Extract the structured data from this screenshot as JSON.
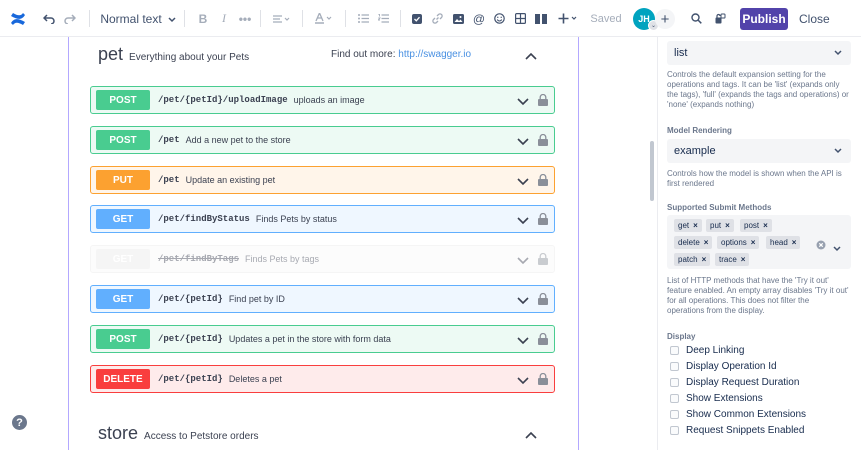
{
  "toolbar": {
    "text_style": "Normal text",
    "saved": "Saved",
    "avatar_initials": "JH",
    "publish": "Publish",
    "close": "Close"
  },
  "tags": [
    {
      "name": "pet",
      "description": "Everything about your Pets",
      "find_more": "Find out more:",
      "link": "http://swagger.io"
    },
    {
      "name": "store",
      "description": "Access to Petstore orders"
    }
  ],
  "operations": [
    {
      "method": "POST",
      "path": "/pet/{petId}/uploadImage",
      "summary": "uploads an image",
      "color": "#49cc90",
      "bg": "#edfaf4"
    },
    {
      "method": "POST",
      "path": "/pet",
      "summary": "Add a new pet to the store",
      "color": "#49cc90",
      "bg": "#edfaf4"
    },
    {
      "method": "PUT",
      "path": "/pet",
      "summary": "Update an existing pet",
      "color": "#fca130",
      "bg": "#fff5ea"
    },
    {
      "method": "GET",
      "path": "/pet/findByStatus",
      "summary": "Finds Pets by status",
      "color": "#61affe",
      "bg": "#eff7ff"
    },
    {
      "method": "GET",
      "path": "/pet/findByTags",
      "summary": "Finds Pets by tags",
      "color": "#ebebeb",
      "bg": "#fafafa",
      "deprecated": true
    },
    {
      "method": "GET",
      "path": "/pet/{petId}",
      "summary": "Find pet by ID",
      "color": "#61affe",
      "bg": "#eff7ff"
    },
    {
      "method": "POST",
      "path": "/pet/{petId}",
      "summary": "Updates a pet in the store with form data",
      "color": "#49cc90",
      "bg": "#edfaf4"
    },
    {
      "method": "DELETE",
      "path": "/pet/{petId}",
      "summary": "Deletes a pet",
      "color": "#f93e3e",
      "bg": "#feebeb"
    }
  ],
  "panel": {
    "doc_expansion_value": "list",
    "doc_expansion_help": [
      "Controls the default expansion setting for the",
      "operations and tags. It can be 'list' (expands only",
      "the tags), 'full' (expands the tags and operations) or",
      "'none' (expands nothing)"
    ],
    "model_rendering_label": "Model Rendering",
    "model_rendering_value": "example",
    "model_rendering_help": [
      "Controls how the model is shown when the API is",
      "first rendered"
    ],
    "submit_methods_label": "Supported Submit Methods",
    "submit_methods": [
      "get",
      "put",
      "post",
      "delete",
      "options",
      "head",
      "patch",
      "trace"
    ],
    "submit_methods_help": [
      "List of HTTP methods that have the 'Try it out'",
      "feature enabled. An empty array disables 'Try it out'",
      "for all operations. This does not filter the",
      "operations from the display."
    ],
    "display_label": "Display",
    "display_options": [
      "Deep Linking",
      "Display Operation Id",
      "Display Request Duration",
      "Show Extensions",
      "Show Common Extensions",
      "Request Snippets Enabled"
    ]
  },
  "colors": {
    "accent": "#5243aa",
    "frame_border": "#b3a8ff"
  }
}
